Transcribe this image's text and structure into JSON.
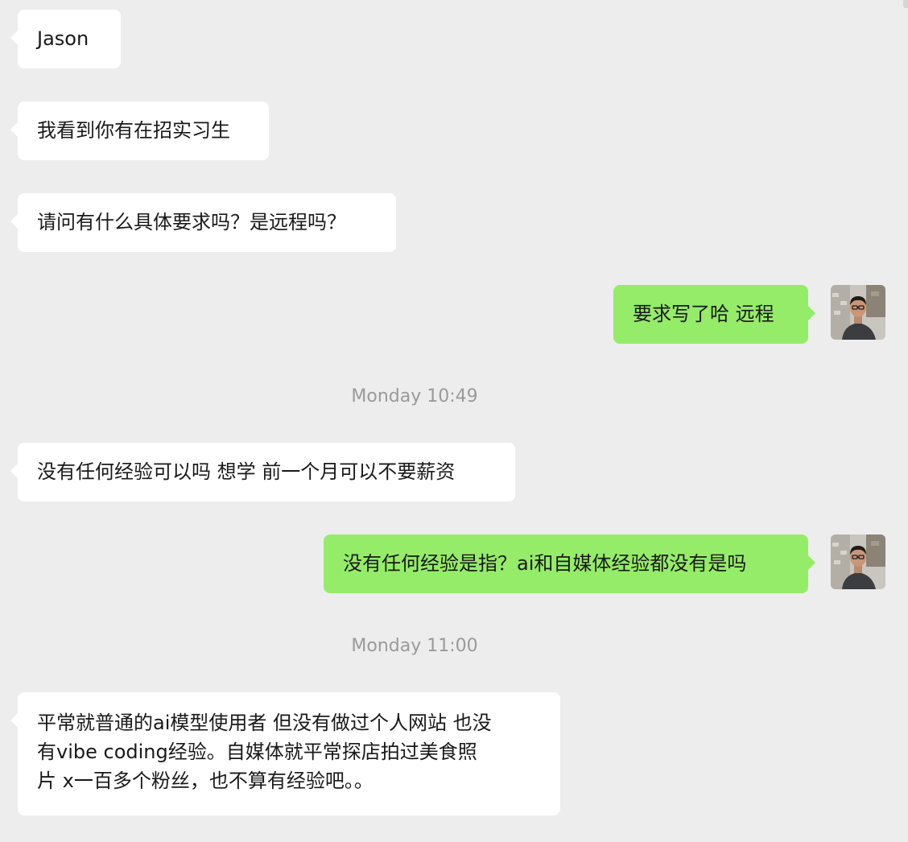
{
  "messages": [
    {
      "direction": "incoming",
      "text": "Jason"
    },
    {
      "direction": "incoming",
      "text": "我看到你有在招实习生"
    },
    {
      "direction": "incoming",
      "text": "请问有什么具体要求吗？是远程吗？"
    },
    {
      "direction": "outgoing",
      "text": "要求写了哈 远程",
      "avatar": "user-avatar"
    },
    {
      "type": "timestamp",
      "text": "Monday 10:49"
    },
    {
      "direction": "incoming",
      "text": "没有任何经验可以吗 想学 前一个月可以不要薪资"
    },
    {
      "direction": "outgoing",
      "text": "没有任何经验是指？ai和自媒体经验都没有是吗",
      "avatar": "user-avatar"
    },
    {
      "type": "timestamp",
      "text": "Monday 11:00"
    },
    {
      "direction": "incoming",
      "text": "平常就普通的ai模型使用者 但没有做过个人网站 也没\n有vibe coding经验。自媒体就平常探店拍过美食照\n片 x一百多个粉丝，也不算有经验吧。。"
    }
  ],
  "colors": {
    "background": "#ededed",
    "incoming_bubble": "#ffffff",
    "outgoing_bubble": "#95ec69",
    "timestamp_text": "#9a9a9a"
  }
}
